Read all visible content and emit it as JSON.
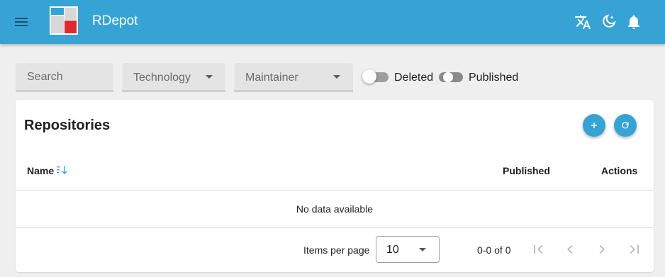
{
  "app": {
    "title": "RDepot"
  },
  "header_icons": [
    "menu-icon",
    "translate-icon",
    "theme-night-icon",
    "bell-icon"
  ],
  "filters": {
    "search_placeholder": "Search",
    "technology_label": "Technology",
    "maintainer_label": "Maintainer",
    "deleted": {
      "label": "Deleted",
      "on": false
    },
    "published": {
      "label": "Published",
      "on": false
    }
  },
  "card": {
    "title": "Repositories",
    "add_icon": "plus-icon",
    "refresh_icon": "refresh-icon"
  },
  "table": {
    "columns": [
      "Name",
      "Published",
      "Actions"
    ],
    "sort_icon": "sort-descending-icon",
    "empty_text": "No data available"
  },
  "pagination": {
    "items_per_page_label": "Items per page",
    "items_per_page": "10",
    "range_text": "0-0 of 0"
  },
  "colors": {
    "primary": "#36a3d5",
    "logo_red": "#e0282f",
    "background": "#efefef"
  }
}
